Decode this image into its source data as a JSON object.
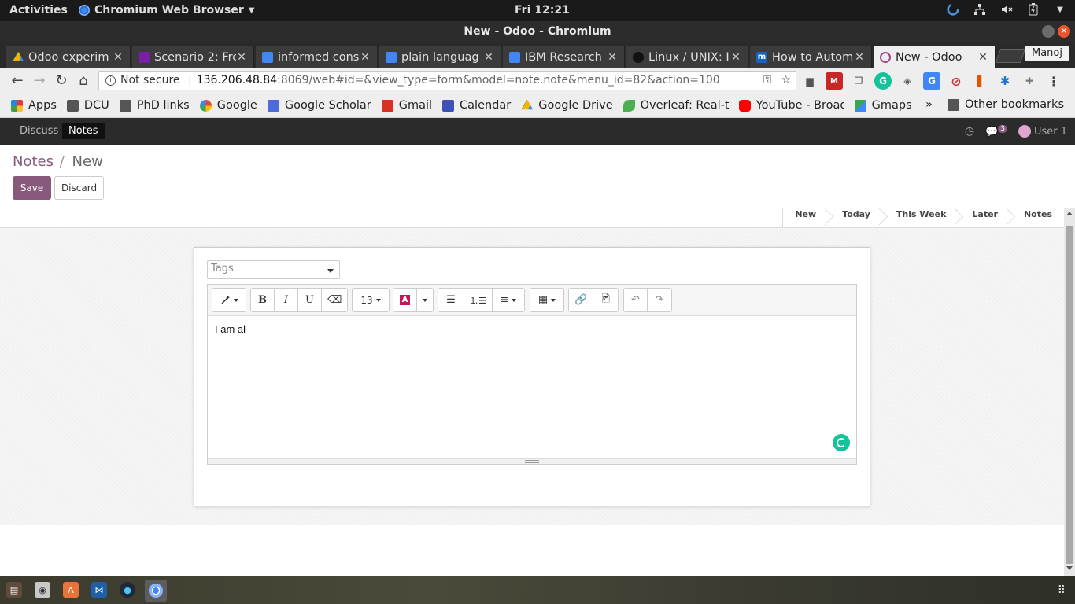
{
  "gnome": {
    "activities": "Activities",
    "app_menu": "Chromium Web Browser",
    "clock": "Fri 12:21"
  },
  "window": {
    "title": "New - Odoo - Chromium"
  },
  "tabs": [
    {
      "label": "Odoo experim",
      "icon": "google-drive-icon",
      "color": "#f4b400"
    },
    {
      "label": "Scenario 2: Fre",
      "icon": "forms-icon",
      "color": "#7b1fa2"
    },
    {
      "label": "informed cons",
      "icon": "google-docs-icon",
      "color": "#4285f4"
    },
    {
      "label": "plain languag",
      "icon": "google-docs-icon",
      "color": "#4285f4"
    },
    {
      "label": "IBM Research",
      "icon": "google-docs-icon",
      "color": "#4285f4"
    },
    {
      "label": "Linux / UNIX: I",
      "icon": "linux-icon",
      "color": "#222222"
    },
    {
      "label": "How to Autom",
      "icon": "medium-m-icon",
      "color": "#1565c0"
    },
    {
      "label": "New - Odoo",
      "icon": "odoo-icon",
      "color": "#a24689"
    }
  ],
  "profile": "Manoj",
  "toolbar": {
    "security": "Not secure",
    "url_host": "136.206.48.84",
    "url_path": ":8069/web#id=&view_type=form&model=note.note&menu_id=82&action=100"
  },
  "bookmarks": [
    {
      "label": "Apps",
      "icon": "apps-grid-icon",
      "color": "#e53935"
    },
    {
      "label": "DCU",
      "icon": "folder-icon",
      "color": "#555555"
    },
    {
      "label": "PhD links",
      "icon": "folder-icon",
      "color": "#555555"
    },
    {
      "label": "Google",
      "icon": "google-g-icon",
      "color": "#4285f4"
    },
    {
      "label": "Google Scholar",
      "icon": "scholar-icon",
      "color": "#4d6ad8"
    },
    {
      "label": "Gmail",
      "icon": "gmail-icon",
      "color": "#d93025"
    },
    {
      "label": "Calendar",
      "icon": "calendar-icon",
      "color": "#3f51b5"
    },
    {
      "label": "Google Drive",
      "icon": "google-drive-icon",
      "color": "#0f9d58"
    },
    {
      "label": "Overleaf: Real-ti",
      "icon": "overleaf-icon",
      "color": "#4caf50"
    },
    {
      "label": "YouTube - Broad",
      "icon": "youtube-icon",
      "color": "#ff0000"
    },
    {
      "label": "Gmaps",
      "icon": "maps-icon",
      "color": "#34a853"
    }
  ],
  "bookmarks_more": "»",
  "bookmarks_other": "Other bookmarks",
  "odoo_nav": {
    "menus": [
      "Discuss",
      "Notes"
    ],
    "active": "Notes",
    "chat_count": "3",
    "user": "User 1"
  },
  "breadcrumb": {
    "parent": "Notes",
    "separator": "/",
    "current": "New"
  },
  "buttons": {
    "save": "Save",
    "discard": "Discard"
  },
  "stages": [
    "New",
    "Today",
    "This Week",
    "Later",
    "Notes"
  ],
  "form": {
    "tags_placeholder": "Tags",
    "font_size": "13",
    "body_text": "I am al"
  },
  "colors": {
    "odoo_primary": "#875A7B",
    "odoo_nav_bg": "#2b2b2b",
    "grammarly": "#15c39a"
  }
}
